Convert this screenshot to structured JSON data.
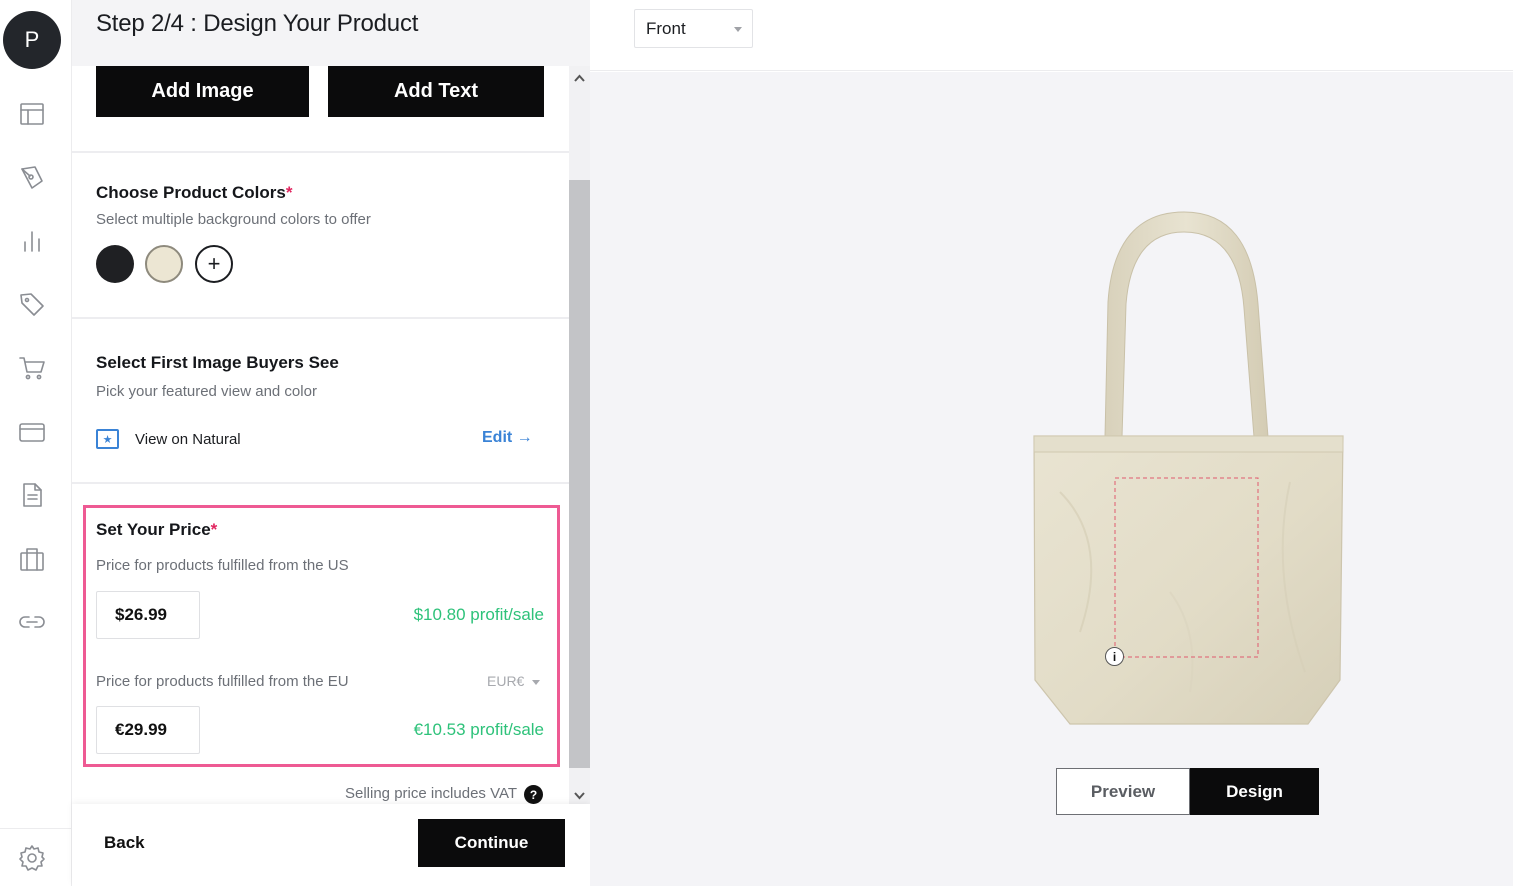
{
  "rail": {
    "avatar_letter": "P",
    "icons": [
      "layout-icon",
      "pen-tool-icon",
      "bar-chart-icon",
      "tag-icon",
      "shopping-cart-icon",
      "credit-card-icon",
      "document-icon",
      "storefront-icon",
      "link-icon",
      "settings-icon"
    ]
  },
  "panel": {
    "step_title": "Step 2/4 : Design Your Product",
    "add_image_label": "Add Image",
    "add_text_label": "Add Text",
    "colors": {
      "title": "Choose Product Colors",
      "required_mark": "*",
      "subtitle": "Select multiple background colors to offer",
      "swatches": [
        "#1f2023",
        "#ece6d3"
      ],
      "add_label": "+"
    },
    "first_image": {
      "title": "Select First Image Buyers See",
      "subtitle": "Pick your featured view and color",
      "view_label": "View on Natural",
      "edit_label": "Edit →"
    },
    "price": {
      "title": "Set Your Price",
      "required_mark": "*",
      "us_label": "Price for products fulfilled from the US",
      "us_value": "$26.99",
      "us_profit": "$10.80 profit/sale",
      "eu_label": "Price for products fulfilled from the EU",
      "eu_currency": "EUR€",
      "eu_value": "€29.99",
      "eu_profit": "€10.53 profit/sale",
      "vat_note": "Selling price includes VAT",
      "help_icon": "?"
    },
    "footer": {
      "back_label": "Back",
      "continue_label": "Continue"
    }
  },
  "canvas": {
    "view_select_value": "Front",
    "info_icon": "i",
    "preview_label": "Preview",
    "design_label": "Design"
  },
  "colors": {
    "accent_pink": "#ee5a93",
    "profit_green": "#2ec27a",
    "link_blue": "#3a83d6",
    "button_black": "#0b0b0c"
  }
}
